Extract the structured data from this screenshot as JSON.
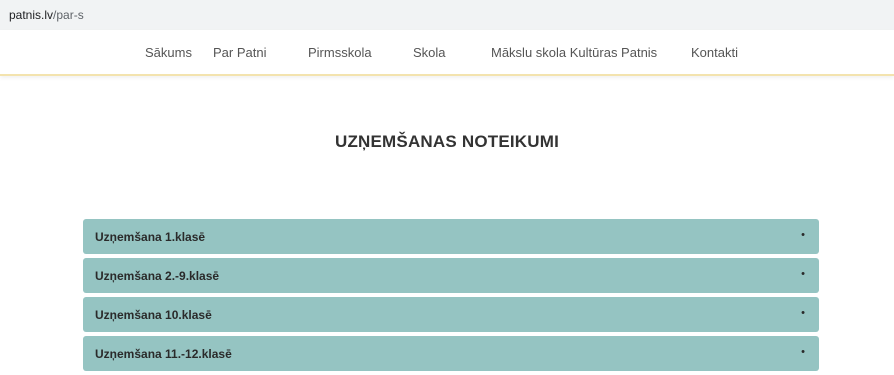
{
  "browser": {
    "url_domain": "patnis.lv",
    "url_path": "/par-s"
  },
  "nav": {
    "items": [
      {
        "label": "Sākums"
      },
      {
        "label": "Par Patni"
      },
      {
        "label": "Pirmsskola"
      },
      {
        "label": "Skola"
      },
      {
        "label": "Mākslu skola Kultūras Patnis"
      },
      {
        "label": "Kontakti"
      }
    ]
  },
  "page": {
    "title": "UZŅEMŠANAS NOTEIKUMI"
  },
  "accordion": {
    "expand_icon": "•",
    "items": [
      {
        "label": "Uzņemšana 1.klasē"
      },
      {
        "label": "Uzņemšana 2.-9.klasē"
      },
      {
        "label": "Uzņemšana 10.klasē"
      },
      {
        "label": "Uzņemšana 11.-12.klasē"
      }
    ]
  }
}
